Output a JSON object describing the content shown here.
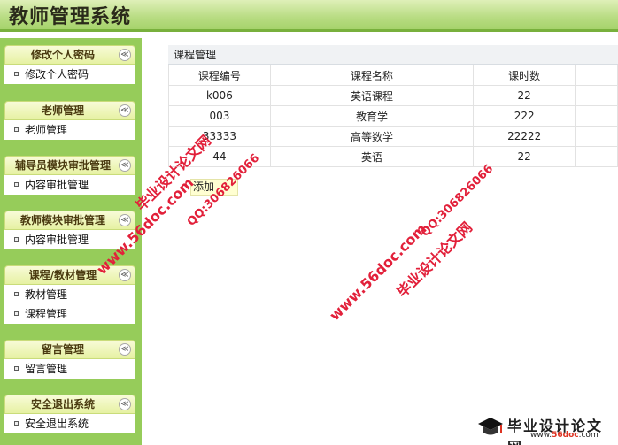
{
  "header": {
    "title": "教师管理系统"
  },
  "sidebar": {
    "sections": [
      {
        "title": "修改个人密码",
        "items": [
          "修改个人密码"
        ]
      },
      {
        "title": "老师管理",
        "items": [
          "老师管理"
        ]
      },
      {
        "title": "辅导员模块审批管理",
        "items": [
          "内容审批管理"
        ]
      },
      {
        "title": "教师模块审批管理",
        "items": [
          "内容审批管理"
        ]
      },
      {
        "title": "课程/教材管理",
        "items": [
          "教材管理",
          "课程管理"
        ]
      },
      {
        "title": "留言管理",
        "items": [
          "留言管理"
        ]
      },
      {
        "title": "安全退出系统",
        "items": [
          "安全退出系统"
        ]
      }
    ],
    "collapse_glyph": "≪"
  },
  "main": {
    "panel_title": "课程管理",
    "columns": [
      "课程编号",
      "课程名称",
      "课时数"
    ],
    "rows": [
      [
        "k006",
        "英语课程",
        "22"
      ],
      [
        "003",
        "教育学",
        "222"
      ],
      [
        "33333",
        "高等数学",
        "22222"
      ],
      [
        "44",
        "英语",
        "22"
      ]
    ],
    "add_button": "添加"
  },
  "watermarks": {
    "site_name": "毕业设计论文网",
    "url": "www.56doc.com",
    "qq": "QQ:306826066",
    "logo_url_prefix": "www.",
    "logo_url_brand": "56doc",
    "logo_url_suffix": ".com",
    "color": "#e2203a"
  }
}
